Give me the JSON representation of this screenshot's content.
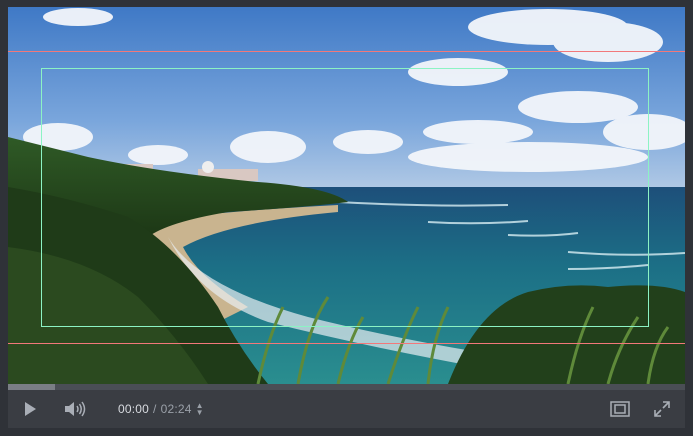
{
  "player": {
    "current_time": "00:00",
    "separator": "/",
    "duration": "02:24",
    "progress_fraction": 0.07
  },
  "icons": {
    "play": "play-icon",
    "volume": "volume-icon",
    "time_stepper": "chevron-updown-icon",
    "safe_area": "safe-area-icon",
    "fullscreen": "fullscreen-icon"
  },
  "colors": {
    "background": "#2f3238",
    "controls": "#3a3d43",
    "guide_red": "#f2787a",
    "guide_green": "#8cf3c4",
    "icon": "#a9aeb6"
  }
}
